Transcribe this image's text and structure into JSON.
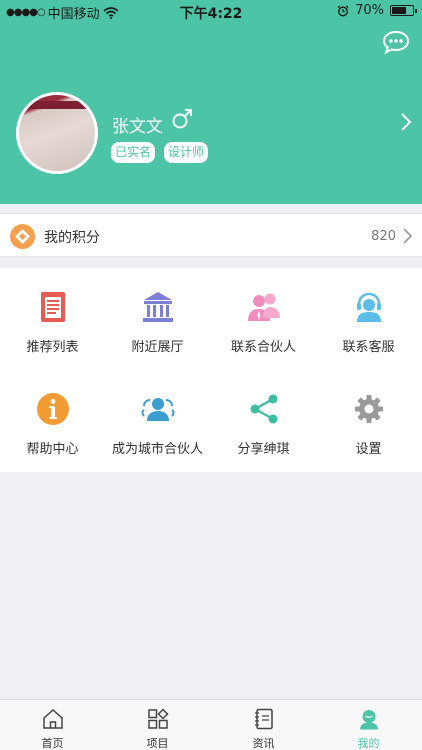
{
  "status_bar": {
    "carrier": "中国移动",
    "time": "下午4:22",
    "battery": "70%"
  },
  "profile": {
    "name": "张文文",
    "tags": [
      "已实名",
      "设计师"
    ]
  },
  "points": {
    "label": "我的积分",
    "value": "820"
  },
  "grid": [
    {
      "label": "推荐列表",
      "icon": "document-list-icon",
      "color": "#e85a54"
    },
    {
      "label": "附近展厅",
      "icon": "bank-icon",
      "color": "#7b7fd6"
    },
    {
      "label": "联系合伙人",
      "icon": "partners-icon",
      "color": "#f08dbd"
    },
    {
      "label": "联系客服",
      "icon": "headset-icon",
      "color": "#5bbde8"
    },
    {
      "label": "帮助中心",
      "icon": "info-icon",
      "color": "#f39c33"
    },
    {
      "label": "成为城市合伙人",
      "icon": "group-icon",
      "color": "#3a9fd0"
    },
    {
      "label": "分享绅琪",
      "icon": "share-icon",
      "color": "#3cbfa0"
    },
    {
      "label": "设置",
      "icon": "gear-icon",
      "color": "#999999"
    }
  ],
  "tabs": [
    {
      "label": "首页",
      "icon": "home-icon"
    },
    {
      "label": "项目",
      "icon": "project-grid-icon"
    },
    {
      "label": "资讯",
      "icon": "notebook-icon"
    },
    {
      "label": "我的",
      "icon": "user-icon",
      "active": true
    }
  ],
  "colors": {
    "brand": "#4cc4a6",
    "points_icon": "#f6a04d"
  }
}
